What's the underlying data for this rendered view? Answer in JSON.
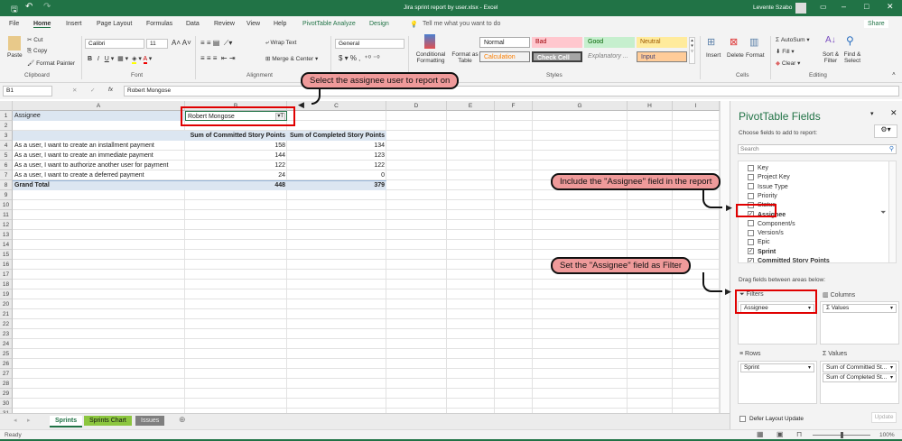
{
  "titlebar": {
    "file_title": "Jira sprint report by user.xlsx  -  Excel",
    "user": "Levente Szabo"
  },
  "tabs": [
    "File",
    "Home",
    "Insert",
    "Page Layout",
    "Formulas",
    "Data",
    "Review",
    "View",
    "Help",
    "PivotTable Analyze",
    "Design"
  ],
  "tell_me": "Tell me what you want to do",
  "share": "Share",
  "ribbon": {
    "clipboard": {
      "paste": "Paste",
      "cut": "Cut",
      "copy": "Copy",
      "format_painter": "Format Painter",
      "label": "Clipboard"
    },
    "font": {
      "name": "Calibri",
      "size": "11",
      "label": "Font"
    },
    "alignment": {
      "wrap": "Wrap Text",
      "merge": "Merge & Center",
      "label": "Alignment"
    },
    "number": {
      "format": "General",
      "label": "Number"
    },
    "styles": {
      "conditional": "Conditional Formatting",
      "format_table": "Format as Table",
      "normal": "Normal",
      "bad": "Bad",
      "good": "Good",
      "neutral": "Neutral",
      "calculation": "Calculation",
      "check_cell": "Check Cell",
      "explanatory": "Explanatory ...",
      "input": "Input",
      "label": "Styles"
    },
    "cells": {
      "insert": "Insert",
      "delete": "Delete",
      "format": "Format",
      "label": "Cells"
    },
    "editing": {
      "autosum": "AutoSum",
      "fill": "Fill",
      "clear": "Clear",
      "sort": "Sort & Filter",
      "find": "Find & Select",
      "label": "Editing"
    }
  },
  "formula_bar": {
    "name_box": "B1",
    "value": "Robert Mongose"
  },
  "columns": [
    "A",
    "B",
    "C",
    "D",
    "E",
    "F",
    "G",
    "H",
    "I"
  ],
  "pivot": {
    "filter_label": "Assignee",
    "filter_value": "Robert Mongose",
    "headers": [
      "Sum of Committed Story Points",
      "Sum of Completed Story Points"
    ],
    "rows": [
      {
        "label": "As a user, I want to create an installment payment",
        "committed": "158",
        "completed": "134"
      },
      {
        "label": "As a user, I want to create an immediate payment",
        "committed": "144",
        "completed": "123"
      },
      {
        "label": "As a user, I want to authorize another user for payment",
        "committed": "122",
        "completed": "122"
      },
      {
        "label": "As a user, I want to create a deferred payment",
        "committed": "24",
        "completed": "0"
      }
    ],
    "total": {
      "label": "Grand Total",
      "committed": "448",
      "completed": "379"
    }
  },
  "callouts": [
    "Select the assignee user to report on",
    "Include the \"Assignee\" field in the report",
    "Set the \"Assignee\" field as Filter"
  ],
  "pane": {
    "title": "PivotTable Fields",
    "choose": "Choose fields to add to report:",
    "search_placeholder": "Search",
    "fields": [
      {
        "name": "Key",
        "checked": false
      },
      {
        "name": "Project Key",
        "checked": false
      },
      {
        "name": "Issue Type",
        "checked": false
      },
      {
        "name": "Priority",
        "checked": false
      },
      {
        "name": "Status",
        "checked": false
      },
      {
        "name": "Assignee",
        "checked": true
      },
      {
        "name": "Component/s",
        "checked": false
      },
      {
        "name": "Version/s",
        "checked": false
      },
      {
        "name": "Epic",
        "checked": false
      },
      {
        "name": "Sprint",
        "checked": true
      },
      {
        "name": "Committed Story Points",
        "checked": true
      }
    ],
    "drag_label": "Drag fields between areas below:",
    "filters": "Filters",
    "columns": "Columns",
    "rows": "Rows",
    "values": "Values",
    "filter_item": "Assignee",
    "column_item": "Values",
    "row_item": "Sprint",
    "value_items": [
      "Sum of Committed St...",
      "Sum of Completed St..."
    ],
    "defer": "Defer Layout Update",
    "update": "Update"
  },
  "sheet_tabs": [
    "Sprints",
    "Sprints Chart",
    "Issues"
  ],
  "status": {
    "ready": "Ready",
    "zoom": "100%"
  }
}
